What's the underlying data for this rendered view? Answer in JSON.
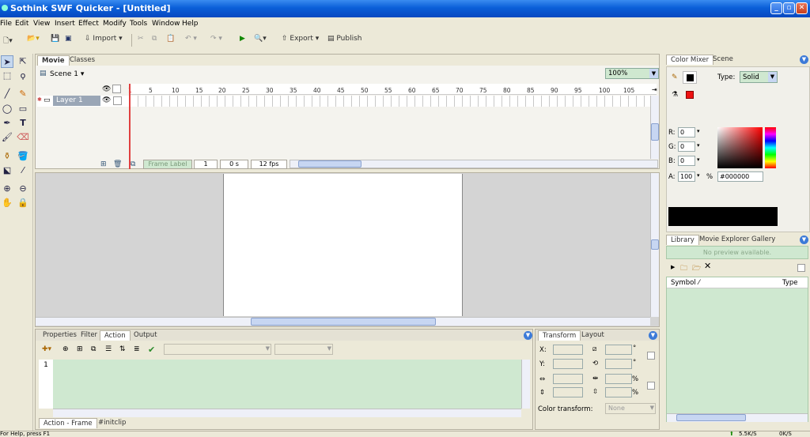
{
  "window": {
    "title": "Sothink SWF Quicker - [Untitled]"
  },
  "menu": [
    "File",
    "Edit",
    "View",
    "Insert",
    "Effect",
    "Modify",
    "Tools",
    "Window",
    "Help"
  ],
  "toolbar": {
    "import": "Import",
    "export": "Export",
    "publish": "Publish"
  },
  "movie_panel": {
    "tabs": [
      "Movie",
      "Classes"
    ],
    "scene": "Scene 1",
    "zoom": "100%",
    "layer": "Layer 1",
    "ruler_ticks": [
      "1",
      "5",
      "10",
      "15",
      "20",
      "25",
      "30",
      "35",
      "40",
      "45",
      "50",
      "55",
      "60",
      "65",
      "70",
      "75",
      "80",
      "85",
      "90",
      "95",
      "100",
      "105"
    ],
    "frame_label": "Frame Label",
    "current_frame": "1",
    "time": "0 s",
    "fps": "12 fps"
  },
  "bottom_panel": {
    "tabs": [
      "Properties",
      "Filter",
      "Action",
      "Output"
    ],
    "line_number": "1",
    "subtabs": [
      "Action - Frame",
      "#initclip"
    ]
  },
  "transform_panel": {
    "tabs": [
      "Transform",
      "Layout"
    ],
    "x_label": "X:",
    "y_label": "Y:",
    "color_transform_label": "Color transform:",
    "color_transform_value": "None",
    "pct": "%",
    "deg": "°"
  },
  "color_mixer": {
    "tabs": [
      "Color Mixer",
      "Scene"
    ],
    "type_label": "Type:",
    "type_value": "Solid",
    "r_label": "R:",
    "r_value": "0",
    "g_label": "G:",
    "g_value": "0",
    "b_label": "B:",
    "b_value": "0",
    "a_label": "A:",
    "a_value": "100",
    "a_unit": "%",
    "hex": "#000000",
    "preview_color": "#000000",
    "fill_color": "#ee1111"
  },
  "library": {
    "tabs": [
      "Library",
      "Movie Explorer",
      "Gallery"
    ],
    "preview_text": "No preview available.",
    "col_symbol": "Symbol",
    "col_type": "Type"
  },
  "status": {
    "help": "For Help, press F1",
    "up_speed": "5.5K/S",
    "down_speed": "0K/S"
  }
}
